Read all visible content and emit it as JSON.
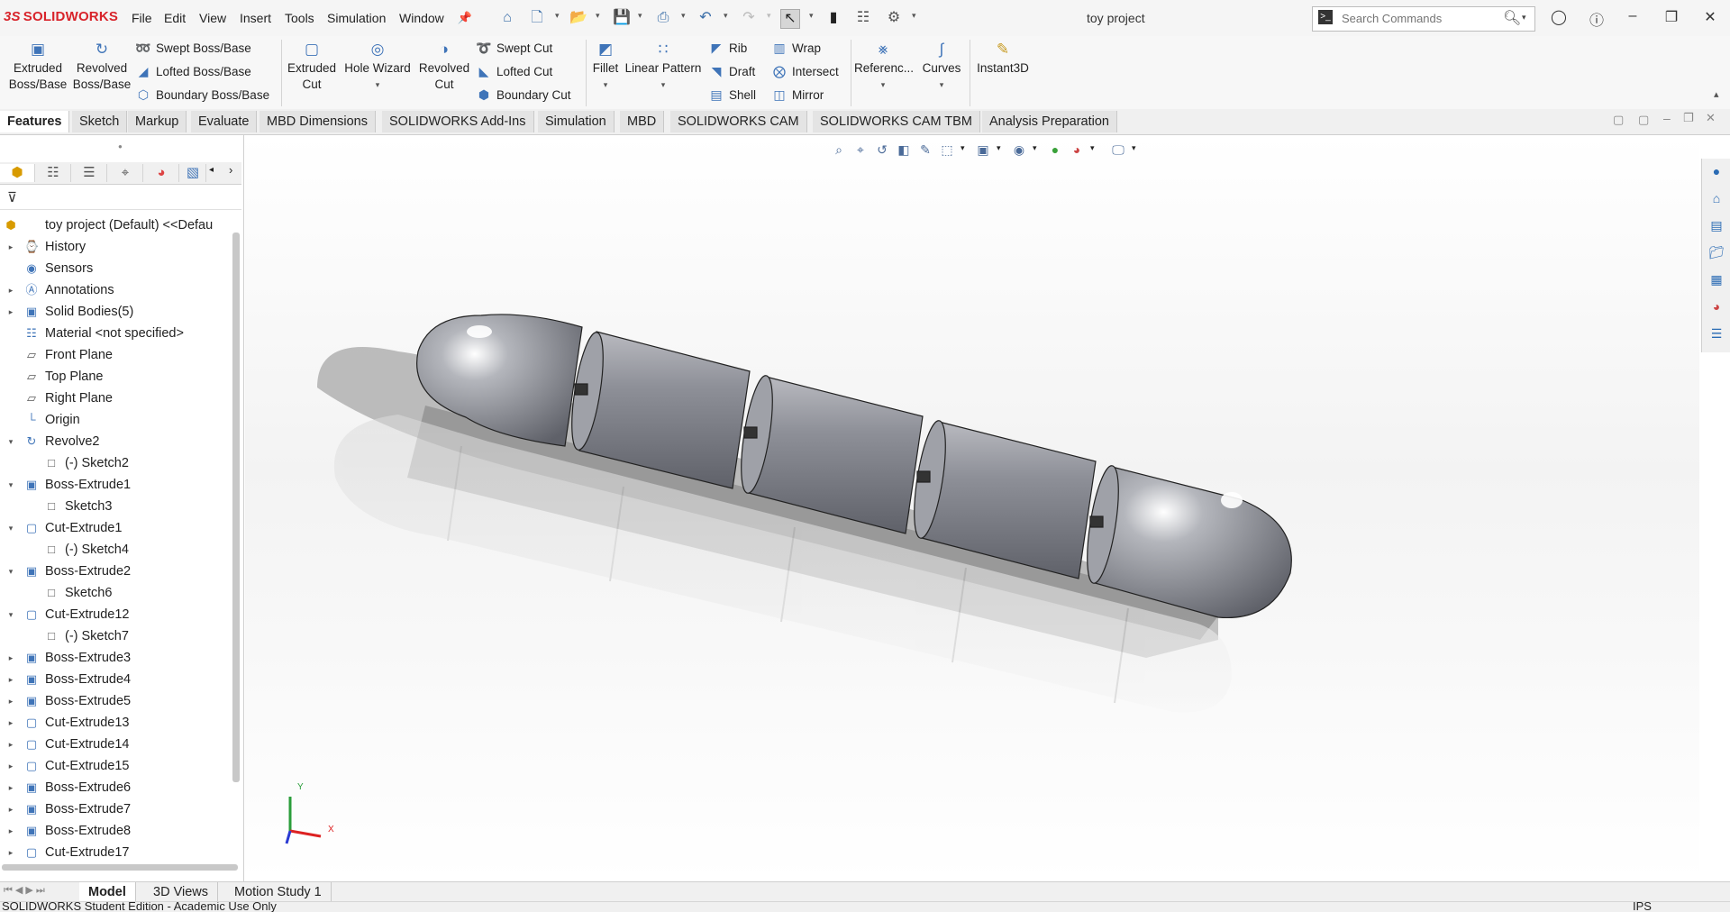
{
  "app": {
    "brand_ds": "3S",
    "brand_name": "SOLIDWORKS",
    "document_title": "toy project"
  },
  "menu": [
    "File",
    "Edit",
    "View",
    "Insert",
    "Tools",
    "Simulation",
    "Window"
  ],
  "search": {
    "placeholder": "Search Commands"
  },
  "command_manager": {
    "extruded_boss": "Extruded\nBoss/Base",
    "revolved_boss": "Revolved\nBoss/Base",
    "swept_boss": "Swept Boss/Base",
    "lofted_boss": "Lofted Boss/Base",
    "boundary_boss": "Boundary Boss/Base",
    "extruded_cut": "Extruded\nCut",
    "hole_wizard": "Hole Wizard",
    "revolved_cut": "Revolved\nCut",
    "swept_cut": "Swept Cut",
    "lofted_cut": "Lofted Cut",
    "boundary_cut": "Boundary Cut",
    "fillet": "Fillet",
    "linear_pattern": "Linear Pattern",
    "rib": "Rib",
    "draft": "Draft",
    "shell": "Shell",
    "wrap": "Wrap",
    "intersect": "Intersect",
    "mirror": "Mirror",
    "reference": "Referenc...",
    "curves": "Curves",
    "instant3d": "Instant3D"
  },
  "tabs": [
    "Features",
    "Sketch",
    "Markup",
    "Evaluate",
    "MBD Dimensions",
    "SOLIDWORKS Add-Ins",
    "Simulation",
    "MBD",
    "SOLIDWORKS CAM",
    "SOLIDWORKS CAM TBM",
    "Analysis Preparation"
  ],
  "tree": [
    {
      "label": "toy project (Default) <<Defau",
      "icon": "part-icon",
      "arrow": ""
    },
    {
      "label": "History",
      "icon": "history-icon",
      "arrow": "right"
    },
    {
      "label": "Sensors",
      "icon": "sensor-icon",
      "arrow": ""
    },
    {
      "label": "Annotations",
      "icon": "annotation-icon",
      "arrow": "right"
    },
    {
      "label": "Solid Bodies(5)",
      "icon": "solid-bodies-icon",
      "arrow": "right"
    },
    {
      "label": "Material <not specified>",
      "icon": "material-icon",
      "arrow": ""
    },
    {
      "label": "Front Plane",
      "icon": "plane-icon",
      "arrow": ""
    },
    {
      "label": "Top Plane",
      "icon": "plane-icon",
      "arrow": ""
    },
    {
      "label": "Right Plane",
      "icon": "plane-icon",
      "arrow": ""
    },
    {
      "label": "Origin",
      "icon": "origin-icon",
      "arrow": ""
    },
    {
      "label": "Revolve2",
      "icon": "revolve-icon",
      "arrow": "down"
    },
    {
      "label": "(-) Sketch2",
      "icon": "sketch-icon",
      "arrow": "",
      "indent": 1
    },
    {
      "label": "Boss-Extrude1",
      "icon": "extrude-icon",
      "arrow": "down"
    },
    {
      "label": "Sketch3",
      "icon": "sketch-icon",
      "arrow": "",
      "indent": 1
    },
    {
      "label": "Cut-Extrude1",
      "icon": "cut-icon",
      "arrow": "down"
    },
    {
      "label": "(-) Sketch4",
      "icon": "sketch-icon",
      "arrow": "",
      "indent": 1
    },
    {
      "label": "Boss-Extrude2",
      "icon": "extrude-icon",
      "arrow": "down"
    },
    {
      "label": "Sketch6",
      "icon": "sketch-icon",
      "arrow": "",
      "indent": 1
    },
    {
      "label": "Cut-Extrude12",
      "icon": "cut-icon",
      "arrow": "down"
    },
    {
      "label": "(-) Sketch7",
      "icon": "sketch-icon",
      "arrow": "",
      "indent": 1
    },
    {
      "label": "Boss-Extrude3",
      "icon": "extrude-icon",
      "arrow": "right"
    },
    {
      "label": "Boss-Extrude4",
      "icon": "extrude-icon",
      "arrow": "right"
    },
    {
      "label": "Boss-Extrude5",
      "icon": "extrude-icon",
      "arrow": "right"
    },
    {
      "label": "Cut-Extrude13",
      "icon": "cut-icon",
      "arrow": "right"
    },
    {
      "label": "Cut-Extrude14",
      "icon": "cut-icon",
      "arrow": "right"
    },
    {
      "label": "Cut-Extrude15",
      "icon": "cut-icon",
      "arrow": "right"
    },
    {
      "label": "Boss-Extrude6",
      "icon": "extrude-icon",
      "arrow": "right"
    },
    {
      "label": "Boss-Extrude7",
      "icon": "extrude-icon",
      "arrow": "right"
    },
    {
      "label": "Boss-Extrude8",
      "icon": "extrude-icon",
      "arrow": "right"
    },
    {
      "label": "Cut-Extrude17",
      "icon": "cut-icon",
      "arrow": "right"
    }
  ],
  "triad": {
    "x": "X",
    "y": "Y"
  },
  "bottom_tabs": [
    "Model",
    "3D Views",
    "Motion Study 1"
  ],
  "status": {
    "left": "SOLIDWORKS Student Edition - Academic Use Only",
    "units": "IPS"
  },
  "colors": {
    "accent": "#3f74b8",
    "brand_red": "#d8232a",
    "body_gray": "#7e8088"
  }
}
